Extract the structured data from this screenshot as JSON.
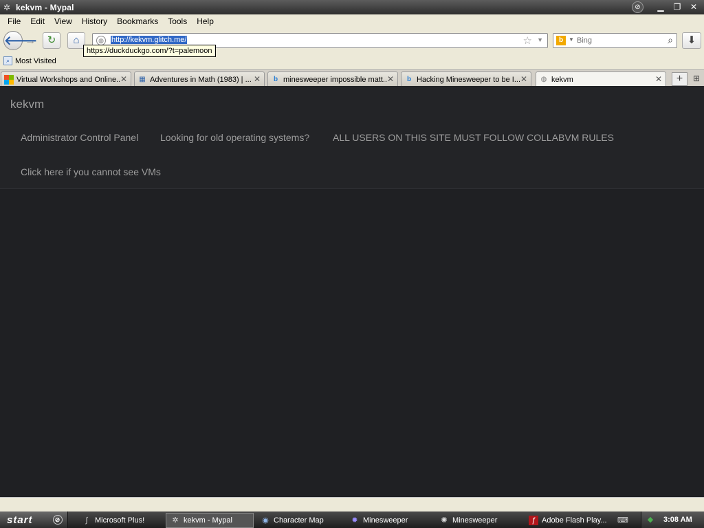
{
  "window": {
    "title": "kekvm - Mypal"
  },
  "menu": [
    "File",
    "Edit",
    "View",
    "History",
    "Bookmarks",
    "Tools",
    "Help"
  ],
  "navbar": {
    "url": "http://kekvm.glitch.me/",
    "search_placeholder": "Bing"
  },
  "tooltip": "https://duckduckgo.com/?t=palemoon",
  "bookmarks": {
    "most_visited": "Most Visited"
  },
  "tabs": [
    {
      "label": "Virtual Workshops and Online..."
    },
    {
      "label": "Adventures in Math (1983) | ..."
    },
    {
      "label": "minesweeper impossible matt..."
    },
    {
      "label": "Hacking Minesweeper to be I..."
    },
    {
      "label": "kekvm"
    }
  ],
  "page": {
    "brand": "kekvm",
    "links": [
      "Administrator Control Panel",
      "Looking for old operating systems?",
      "ALL USERS ON THIS SITE MUST FOLLOW COLLABVM RULES",
      "Click here if you cannot see VMs"
    ]
  },
  "taskbar": {
    "start": "start",
    "tasks": [
      {
        "label": "Microsoft Plus!"
      },
      {
        "label": "kekvm - Mypal"
      },
      {
        "label": "Character Map"
      },
      {
        "label": "Minesweeper"
      },
      {
        "label": "Minesweeper"
      },
      {
        "label": "Adobe Flash Play..."
      }
    ],
    "clock": "3:08 AM"
  }
}
